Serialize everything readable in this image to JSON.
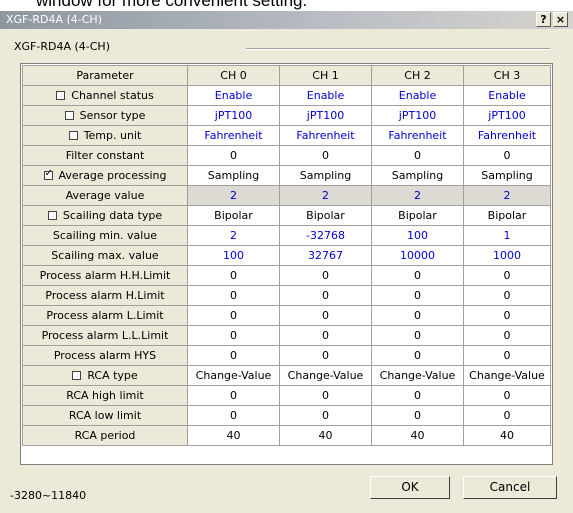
{
  "caption": "window for more convenient setting.",
  "window": {
    "title": "XGF-RD4A (4-CH)",
    "help": "?",
    "close": "×"
  },
  "group_label": "XGF-RD4A (4-CH)",
  "table": {
    "headers": [
      "Parameter",
      "CH 0",
      "CH 1",
      "CH 2",
      "CH 3"
    ],
    "rows": [
      {
        "label": "Channel status",
        "checkbox": true,
        "checked": false,
        "values": [
          "Enable",
          "Enable",
          "Enable",
          "Enable"
        ],
        "blue": true,
        "shaded": false
      },
      {
        "label": "Sensor type",
        "checkbox": true,
        "checked": false,
        "values": [
          "jPT100",
          "jPT100",
          "jPT100",
          "jPT100"
        ],
        "blue": true,
        "shaded": false
      },
      {
        "label": "Temp. unit",
        "checkbox": true,
        "checked": false,
        "values": [
          "Fahrenheit",
          "Fahrenheit",
          "Fahrenheit",
          "Fahrenheit"
        ],
        "blue": true,
        "shaded": false
      },
      {
        "label": "Filter constant",
        "checkbox": false,
        "checked": false,
        "values": [
          "0",
          "0",
          "0",
          "0"
        ],
        "blue": false,
        "shaded": false
      },
      {
        "label": "Average processing",
        "checkbox": true,
        "checked": true,
        "values": [
          "Sampling",
          "Sampling",
          "Sampling",
          "Sampling"
        ],
        "blue": false,
        "shaded": false
      },
      {
        "label": "Average value",
        "checkbox": false,
        "checked": false,
        "values": [
          "2",
          "2",
          "2",
          "2"
        ],
        "blue": true,
        "shaded": true
      },
      {
        "label": "Scailing data type",
        "checkbox": true,
        "checked": false,
        "values": [
          "Bipolar",
          "Bipolar",
          "Bipolar",
          "Bipolar"
        ],
        "blue": false,
        "shaded": false
      },
      {
        "label": "Scailing min. value",
        "checkbox": false,
        "checked": false,
        "values": [
          "2",
          "-32768",
          "100",
          "1"
        ],
        "blue": true,
        "shaded": false
      },
      {
        "label": "Scailing max. value",
        "checkbox": false,
        "checked": false,
        "values": [
          "100",
          "32767",
          "10000",
          "1000"
        ],
        "blue": true,
        "shaded": false
      },
      {
        "label": "Process alarm H.H.Limit",
        "checkbox": false,
        "checked": false,
        "values": [
          "0",
          "0",
          "0",
          "0"
        ],
        "blue": false,
        "shaded": false
      },
      {
        "label": "Process alarm H.Limit",
        "checkbox": false,
        "checked": false,
        "values": [
          "0",
          "0",
          "0",
          "0"
        ],
        "blue": false,
        "shaded": false
      },
      {
        "label": "Process alarm L.Limit",
        "checkbox": false,
        "checked": false,
        "values": [
          "0",
          "0",
          "0",
          "0"
        ],
        "blue": false,
        "shaded": false
      },
      {
        "label": "Process alarm L.L.Limit",
        "checkbox": false,
        "checked": false,
        "values": [
          "0",
          "0",
          "0",
          "0"
        ],
        "blue": false,
        "shaded": false
      },
      {
        "label": "Process alarm HYS",
        "checkbox": false,
        "checked": false,
        "values": [
          "0",
          "0",
          "0",
          "0"
        ],
        "blue": false,
        "shaded": false
      },
      {
        "label": "RCA type",
        "checkbox": true,
        "checked": false,
        "values": [
          "Change-Value",
          "Change-Value",
          "Change-Value",
          "Change-Value"
        ],
        "blue": false,
        "shaded": false
      },
      {
        "label": "RCA high limit",
        "checkbox": false,
        "checked": false,
        "values": [
          "0",
          "0",
          "0",
          "0"
        ],
        "blue": false,
        "shaded": false
      },
      {
        "label": "RCA low limit",
        "checkbox": false,
        "checked": false,
        "values": [
          "0",
          "0",
          "0",
          "0"
        ],
        "blue": false,
        "shaded": false
      },
      {
        "label": "RCA period",
        "checkbox": false,
        "checked": false,
        "values": [
          "40",
          "40",
          "40",
          "40"
        ],
        "blue": false,
        "shaded": false
      }
    ]
  },
  "status_text": "-3280~11840",
  "buttons": {
    "ok": "OK",
    "cancel": "Cancel"
  },
  "colors": {
    "blue_value": "#0000d0",
    "dialog_bg": "#ece9d8"
  }
}
